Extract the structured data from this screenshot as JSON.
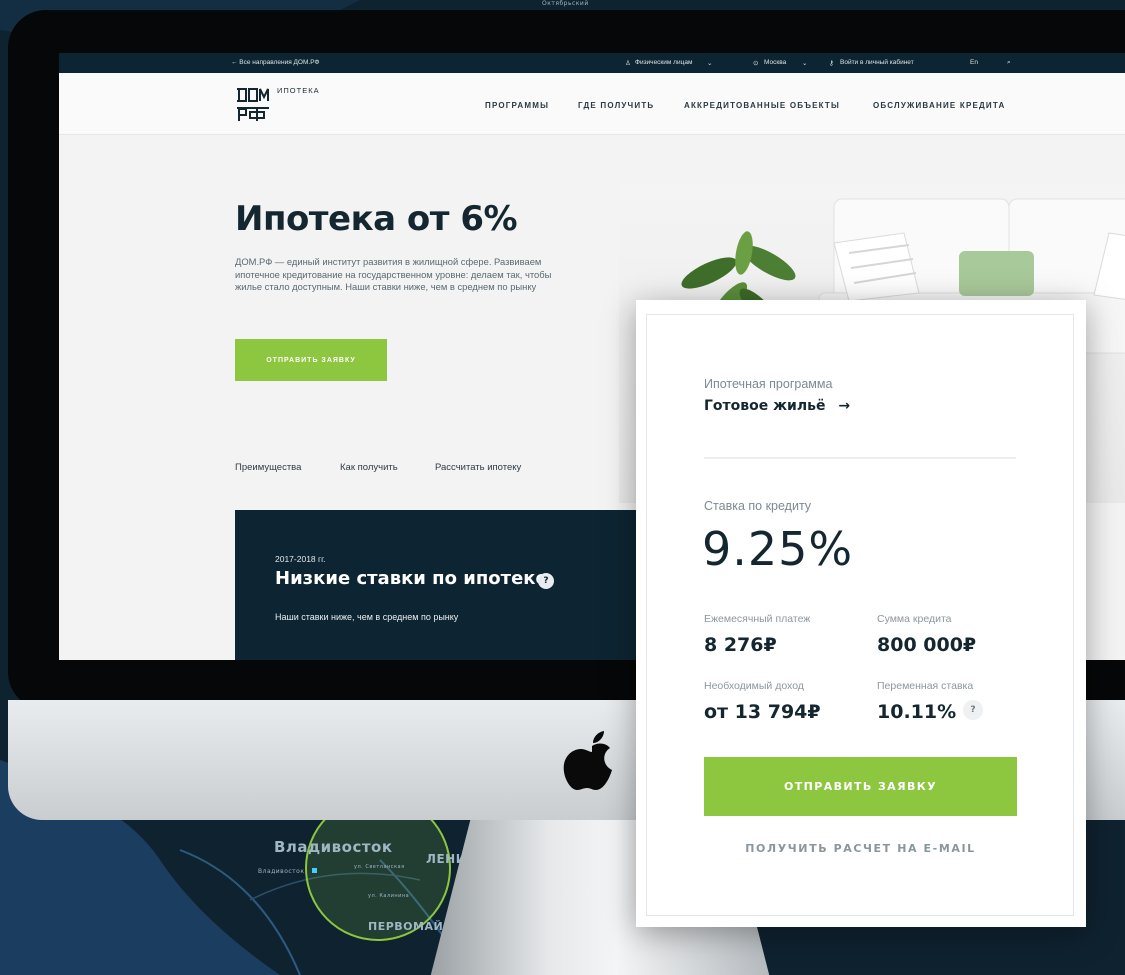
{
  "background_map": {
    "city_label": "Владивосток",
    "city_small": "Владивосток",
    "district_1": "ЛЕНИНС",
    "district_2": "ПЕРВОМАЙСКИЙ",
    "top_label": "Октябрьский",
    "street_1": "ул. Светланская",
    "street_2": "ул. Калинина"
  },
  "topbar": {
    "all_directions": "← Все направления ДОМ.РФ",
    "individuals": "Физическим лицам",
    "city": "Москва",
    "login": "Войти в личный кабинет",
    "lang": "En"
  },
  "navbar": {
    "logo_sub": "ИПОТЕКА",
    "items": [
      "ПРОГРАММЫ",
      "ГДЕ ПОЛУЧИТЬ",
      "АККРЕДИТОВАННЫЕ ОБЪЕКТЫ",
      "ОБСЛУЖИВАНИЕ КРЕДИТА"
    ]
  },
  "hero": {
    "title": "Ипотека от 6%",
    "description": "ДОМ.РФ — единый институт развития в жилищной сфере. Развиваем ипотечное кредитование на государственном уровне: делаем так, чтобы жилье стало доступным. Наши ставки ниже, чем в среднем по рынку",
    "button": "ОТПРАВИТЬ ЗАЯВКУ"
  },
  "subnav": [
    "Преимущества",
    "Как получить",
    "Рассчитать ипотеку"
  ],
  "rates_panel": {
    "years": "2017-2018 гг.",
    "title": "Низкие ставки по ипотеке",
    "help": "?",
    "description": "Наши ставки ниже, чем в среднем по рынку"
  },
  "card": {
    "program_label": "Ипотечная программа",
    "program_value": "Готовое жильё",
    "program_arrow": "→",
    "rate_label": "Ставка по кредиту",
    "rate_value": "9.25%",
    "monthly_label": "Ежемесячный платеж",
    "monthly_value": "8 276₽",
    "loan_label": "Сумма кредита",
    "loan_value": "800 000₽",
    "income_label": "Необходимый доход",
    "income_value": "от 13 794₽",
    "variable_label": "Переменная ставка",
    "variable_value": "10.11%",
    "variable_help": "?",
    "submit_button": "ОТПРАВИТЬ ЗАЯВКУ",
    "email_link": "ПОЛУЧИТЬ РАСЧЕТ НА E-MAIL"
  },
  "colors": {
    "accent_green": "#8dc63f",
    "dark_navy": "#0d2532",
    "background": "#0f2230"
  }
}
